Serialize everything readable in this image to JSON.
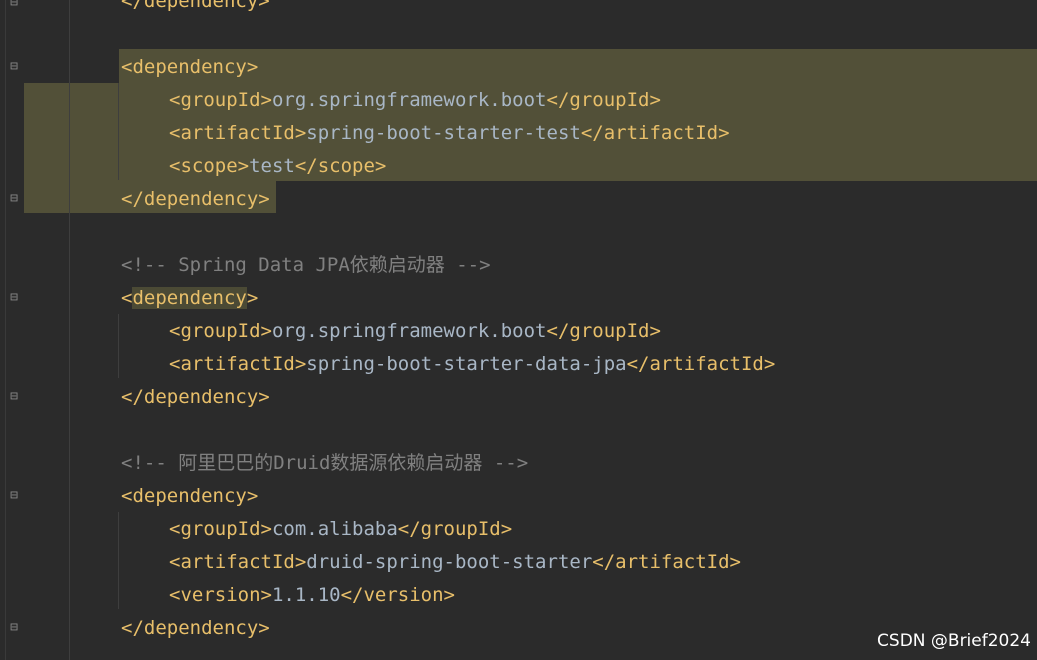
{
  "lines": [
    {
      "indent": 0,
      "parts": [
        {
          "t": "tag",
          "v": "</dependency>"
        }
      ]
    },
    {
      "indent": 0,
      "parts": []
    },
    {
      "indent": 0,
      "parts": [
        {
          "t": "tag",
          "v": "<dependency>"
        }
      ]
    },
    {
      "indent": 1,
      "parts": [
        {
          "t": "tag",
          "v": "<groupId>"
        },
        {
          "t": "txt",
          "v": "org.springframework.boot"
        },
        {
          "t": "tag",
          "v": "</groupId>"
        }
      ]
    },
    {
      "indent": 1,
      "parts": [
        {
          "t": "tag",
          "v": "<artifactId>"
        },
        {
          "t": "txt",
          "v": "spring-boot-starter-test"
        },
        {
          "t": "tag",
          "v": "</artifactId>"
        }
      ]
    },
    {
      "indent": 1,
      "parts": [
        {
          "t": "tag",
          "v": "<scope>"
        },
        {
          "t": "txt",
          "v": "test"
        },
        {
          "t": "tag",
          "v": "</scope>"
        }
      ]
    },
    {
      "indent": 0,
      "parts": [
        {
          "t": "tag",
          "v": "</dependency>"
        }
      ]
    },
    {
      "indent": 0,
      "parts": []
    },
    {
      "indent": 0,
      "parts": [
        {
          "t": "cmt",
          "v": "<!-- Spring Data JPA依赖启动器 -->"
        }
      ]
    },
    {
      "indent": 0,
      "parts": [
        {
          "t": "tag",
          "v": "<"
        },
        {
          "t": "tagm",
          "v": "dependency"
        },
        {
          "t": "tag",
          "v": ">"
        }
      ]
    },
    {
      "indent": 1,
      "parts": [
        {
          "t": "tag",
          "v": "<groupId>"
        },
        {
          "t": "txt",
          "v": "org.springframework.boot"
        },
        {
          "t": "tag",
          "v": "</groupId>"
        }
      ]
    },
    {
      "indent": 1,
      "parts": [
        {
          "t": "tag",
          "v": "<artifactId>"
        },
        {
          "t": "txt",
          "v": "spring-boot-starter-data-jpa"
        },
        {
          "t": "tag",
          "v": "</artifactId>"
        }
      ]
    },
    {
      "indent": 0,
      "parts": [
        {
          "t": "tag",
          "v": "</dependency>"
        }
      ]
    },
    {
      "indent": 0,
      "parts": []
    },
    {
      "indent": 0,
      "parts": [
        {
          "t": "cmt",
          "v": "<!-- 阿里巴巴的Druid数据源依赖启动器 -->"
        }
      ]
    },
    {
      "indent": 0,
      "parts": [
        {
          "t": "tag",
          "v": "<dependency>"
        }
      ]
    },
    {
      "indent": 1,
      "parts": [
        {
          "t": "tag",
          "v": "<groupId>"
        },
        {
          "t": "txt",
          "v": "com.alibaba"
        },
        {
          "t": "tag",
          "v": "</groupId>"
        }
      ]
    },
    {
      "indent": 1,
      "parts": [
        {
          "t": "tag",
          "v": "<artifactId>"
        },
        {
          "t": "txt",
          "v": "druid-spring-boot-starter"
        },
        {
          "t": "tag",
          "v": "</artifactId>"
        }
      ]
    },
    {
      "indent": 1,
      "parts": [
        {
          "t": "tag",
          "v": "<version>"
        },
        {
          "t": "txt",
          "v": "1.1.10"
        },
        {
          "t": "tag",
          "v": "</version>"
        }
      ]
    },
    {
      "indent": 0,
      "parts": [
        {
          "t": "tag",
          "v": "</dependency>"
        }
      ]
    }
  ],
  "colors": {
    "background": "#2b2b2b",
    "tag": "#e8bf6a",
    "text": "#a9b7c6",
    "comment": "#808080",
    "highlight": "#525038"
  },
  "watermark": "CSDN @Brief2024"
}
